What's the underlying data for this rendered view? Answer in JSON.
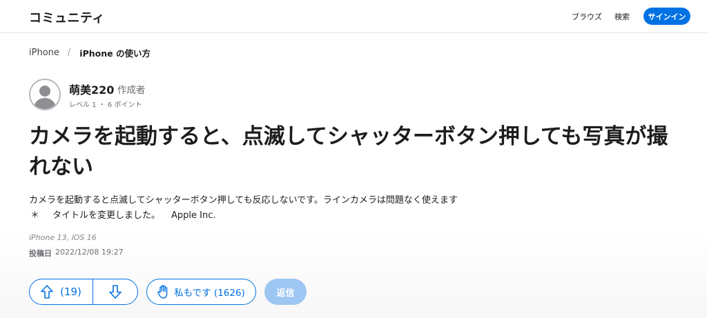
{
  "header": {
    "brand": "コミュニティ",
    "browse": "ブラウズ",
    "search": "検索",
    "signin": "サインイン"
  },
  "breadcrumb": {
    "parent": "iPhone",
    "separator": "/",
    "current": "iPhone の使い方"
  },
  "author": {
    "name": "萌美220",
    "role": "作成者",
    "meta": "レベル 1 ・ 6 ポイント"
  },
  "post": {
    "title": "カメラを起動すると、点滅してシャッターボタン押しても写真が撮れない",
    "body": "カメラを起動すると点滅してシャッターボタン押しても反応しないです。ラインカメラは問題なく使えます",
    "note_star": "＊",
    "note_text": "タイトルを変更しました。",
    "note_company": "Apple Inc.",
    "device": "iPhone 13, iOS 16",
    "posted_label": "投稿日",
    "posted_date": "2022/12/08 19:27"
  },
  "actions": {
    "upvote_count": "(19)",
    "metoo_label": "私もです (1626)",
    "reply_label": "返信"
  },
  "colors": {
    "accent": "#0071e3",
    "reply_disabled": "#9ec6f2"
  },
  "icons": {
    "avatar": "user-silhouette-icon",
    "upvote": "arrow-up-icon",
    "downvote": "arrow-down-icon",
    "metoo": "raised-hand-icon"
  }
}
